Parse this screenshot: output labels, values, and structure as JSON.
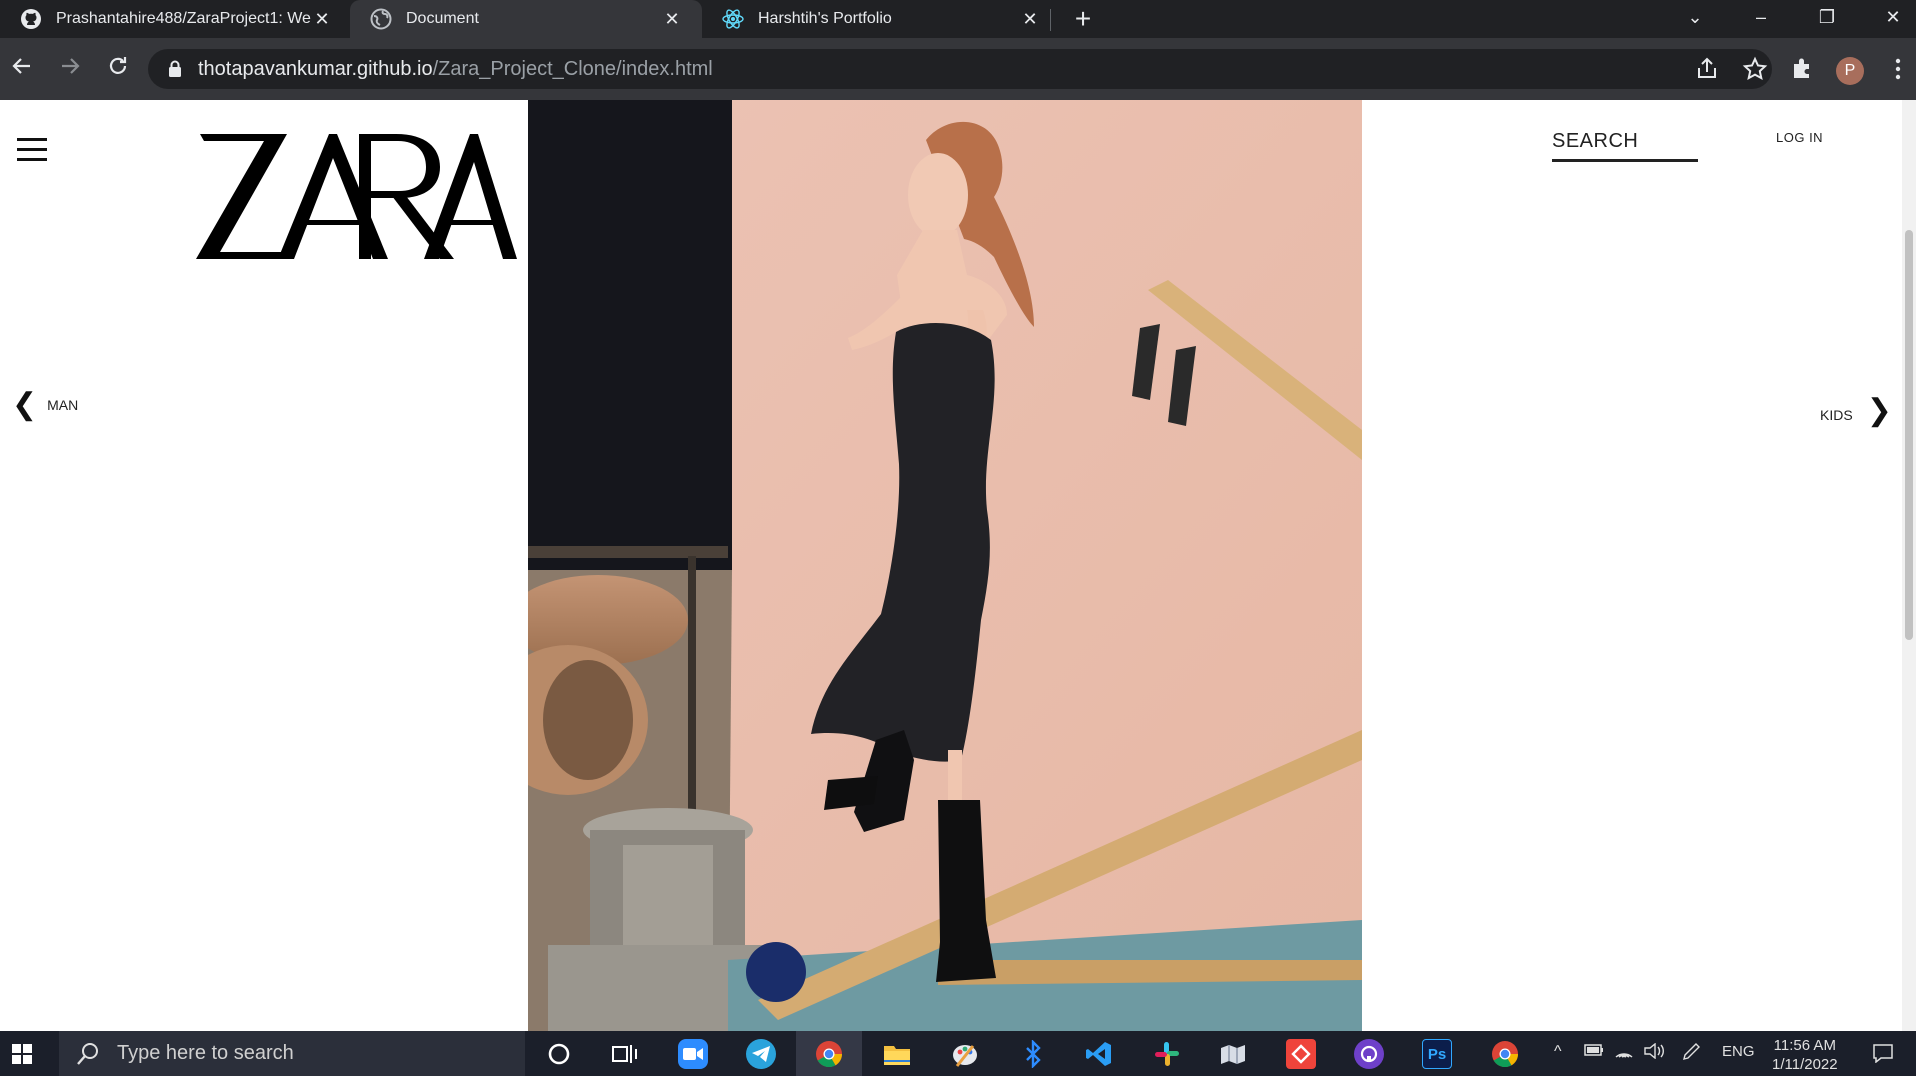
{
  "browser": {
    "tabs": [
      {
        "title": "Prashantahire488/ZaraProject1: We",
        "icon": "github-icon",
        "active": false
      },
      {
        "title": "Document",
        "icon": "globe-icon",
        "active": true
      },
      {
        "title": "Harshtih's Portfolio",
        "icon": "react-icon",
        "active": false
      }
    ],
    "url_domain": "thotapavankumar.github.io",
    "url_path": "/Zara_Project_Clone/index.html",
    "profile_initial": "P"
  },
  "site": {
    "logo_text": "ZARA",
    "search_label": "SEARCH",
    "login_label": "LOG IN",
    "prev_category": "MAN",
    "next_category": "KIDS"
  },
  "taskbar": {
    "search_placeholder": "Type here to search",
    "apps": [
      "cortana-icon",
      "task-view-icon",
      "zoom-icon",
      "telegram-icon",
      "chrome-icon",
      "file-explorer-icon",
      "paint-icon",
      "bluetooth-icon",
      "vscode-icon",
      "slack-icon",
      "maps-icon",
      "anydesk-icon",
      "github-desktop-icon",
      "photoshop-icon",
      "chrome-icon"
    ],
    "photoshop_label": "Ps",
    "language": "ENG",
    "time": "11:56 AM",
    "date": "1/11/2022"
  },
  "colors": {
    "tab_bg": "#202124",
    "toolbar_bg": "#35363a",
    "taskbar_bg": "#1b1f2a",
    "hero_wall": "#ecc3b4"
  }
}
